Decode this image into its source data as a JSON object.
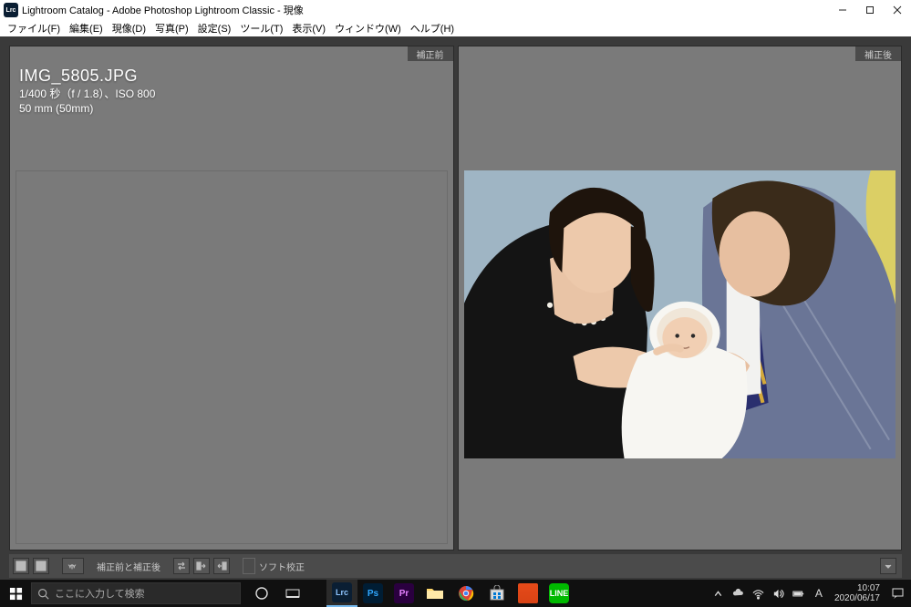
{
  "window": {
    "app_icon_text": "Lrc",
    "title": "Lightroom Catalog - Adobe Photoshop Lightroom Classic - 現像"
  },
  "menus": {
    "file": "ファイル(F)",
    "edit": "編集(E)",
    "develop": "現像(D)",
    "photo": "写真(P)",
    "settings": "設定(S)",
    "tool": "ツール(T)",
    "view": "表示(V)",
    "window": "ウィンドウ(W)",
    "help": "ヘルプ(H)"
  },
  "compare": {
    "before_label": "補正前",
    "after_label": "補正後",
    "filename": "IMG_5805.JPG",
    "exposure_line": "1/400 秒（f / 1.8）、ISO 800",
    "lens_line": "50 mm (50mm)"
  },
  "toolbar": {
    "before_after_text": "補正前と補正後",
    "soft_proof_label": "ソフト校正"
  },
  "taskbar": {
    "search_placeholder": "ここに入力して検索",
    "clock_time": "10:07",
    "clock_date": "2020/06/17",
    "ime_label": "A"
  }
}
